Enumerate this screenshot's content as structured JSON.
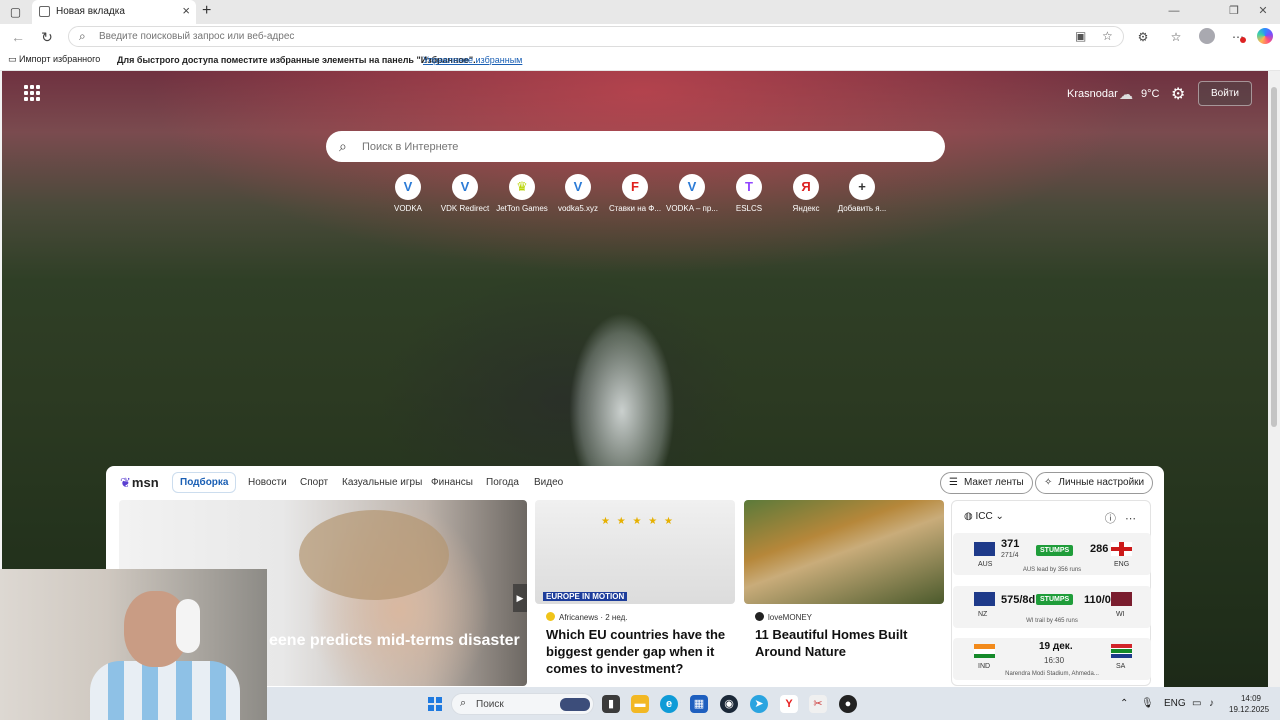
{
  "browser": {
    "tab_title": "Новая вкладка",
    "address_placeholder": "Введите поисковый запрос или веб-адрес"
  },
  "favorites_bar": {
    "import_label": "Импорт избранного",
    "hint": "Для быстрого доступа поместите избранные элементы на панель \"Избранное\".",
    "manage_link": "Управление избранным"
  },
  "newtab": {
    "weather": {
      "city": "Krasnodar",
      "temp": "9°C"
    },
    "signin_label": "Войти",
    "search_placeholder": "Поиск в Интернете",
    "quick_links": [
      {
        "label": "VODKA",
        "icon": "V",
        "color": "#2b7bd6"
      },
      {
        "label": "VDK Redirect",
        "icon": "V",
        "color": "#2b7bd6"
      },
      {
        "label": "JetTon Games",
        "icon": "♛",
        "color": "#b8d400"
      },
      {
        "label": "vodka5.xyz",
        "icon": "V",
        "color": "#2b7bd6"
      },
      {
        "label": "Ставки на Ф...",
        "icon": "F",
        "color": "#e0201c"
      },
      {
        "label": "VODKA – пр...",
        "icon": "V",
        "color": "#2b7bd6"
      },
      {
        "label": "ESLCS",
        "icon": "T",
        "color": "#9146ff"
      },
      {
        "label": "Яндекс",
        "icon": "Я",
        "color": "#d22"
      },
      {
        "label": "Добавить я...",
        "icon": "+",
        "color": "#333"
      }
    ]
  },
  "msn": {
    "logo_text": "msn",
    "tabs": [
      "Подборка",
      "Новости",
      "Спорт",
      "Казуальные игры",
      "Финансы",
      "Погода",
      "Видео"
    ],
    "layout_button": "Макет ленты",
    "personalize_button": "Личные настройки",
    "hero_caption": "eene predicts mid-terms disaster",
    "cards": [
      {
        "source": "Africanews",
        "time": "2 нед.",
        "title": "Which EU countries have the biggest gender gap when it comes to investment?",
        "image_text": "EUROPE IN MOTION"
      },
      {
        "source": "loveMONEY",
        "time": "",
        "title": "11 Beautiful Homes Built Around Nature"
      }
    ],
    "cricket": {
      "title": "ICC",
      "matches": [
        {
          "team1": "AUS",
          "score1": "371",
          "sub1": "271/4",
          "status": "STUMPS",
          "score2": "286",
          "team2": "ENG",
          "note": "AUS lead by 356 runs"
        },
        {
          "team1": "NZ",
          "score1": "575/8d",
          "sub1": "",
          "status": "STUMPS",
          "score2": "110/0",
          "team2": "WI",
          "note": "WI trail by 465 runs"
        },
        {
          "team1": "IND",
          "date": "19 дек.",
          "time": "16:30",
          "team2": "SA",
          "note": "Narendra Modi Stadium, Ahmeda..."
        }
      ]
    }
  },
  "taskbar": {
    "search_label": "Поиск",
    "language": "ENG",
    "time": "14:09",
    "date": "19.12.2025"
  },
  "colors": {
    "accent": "#1a5fb4",
    "stumps": "#1f9d3a"
  }
}
